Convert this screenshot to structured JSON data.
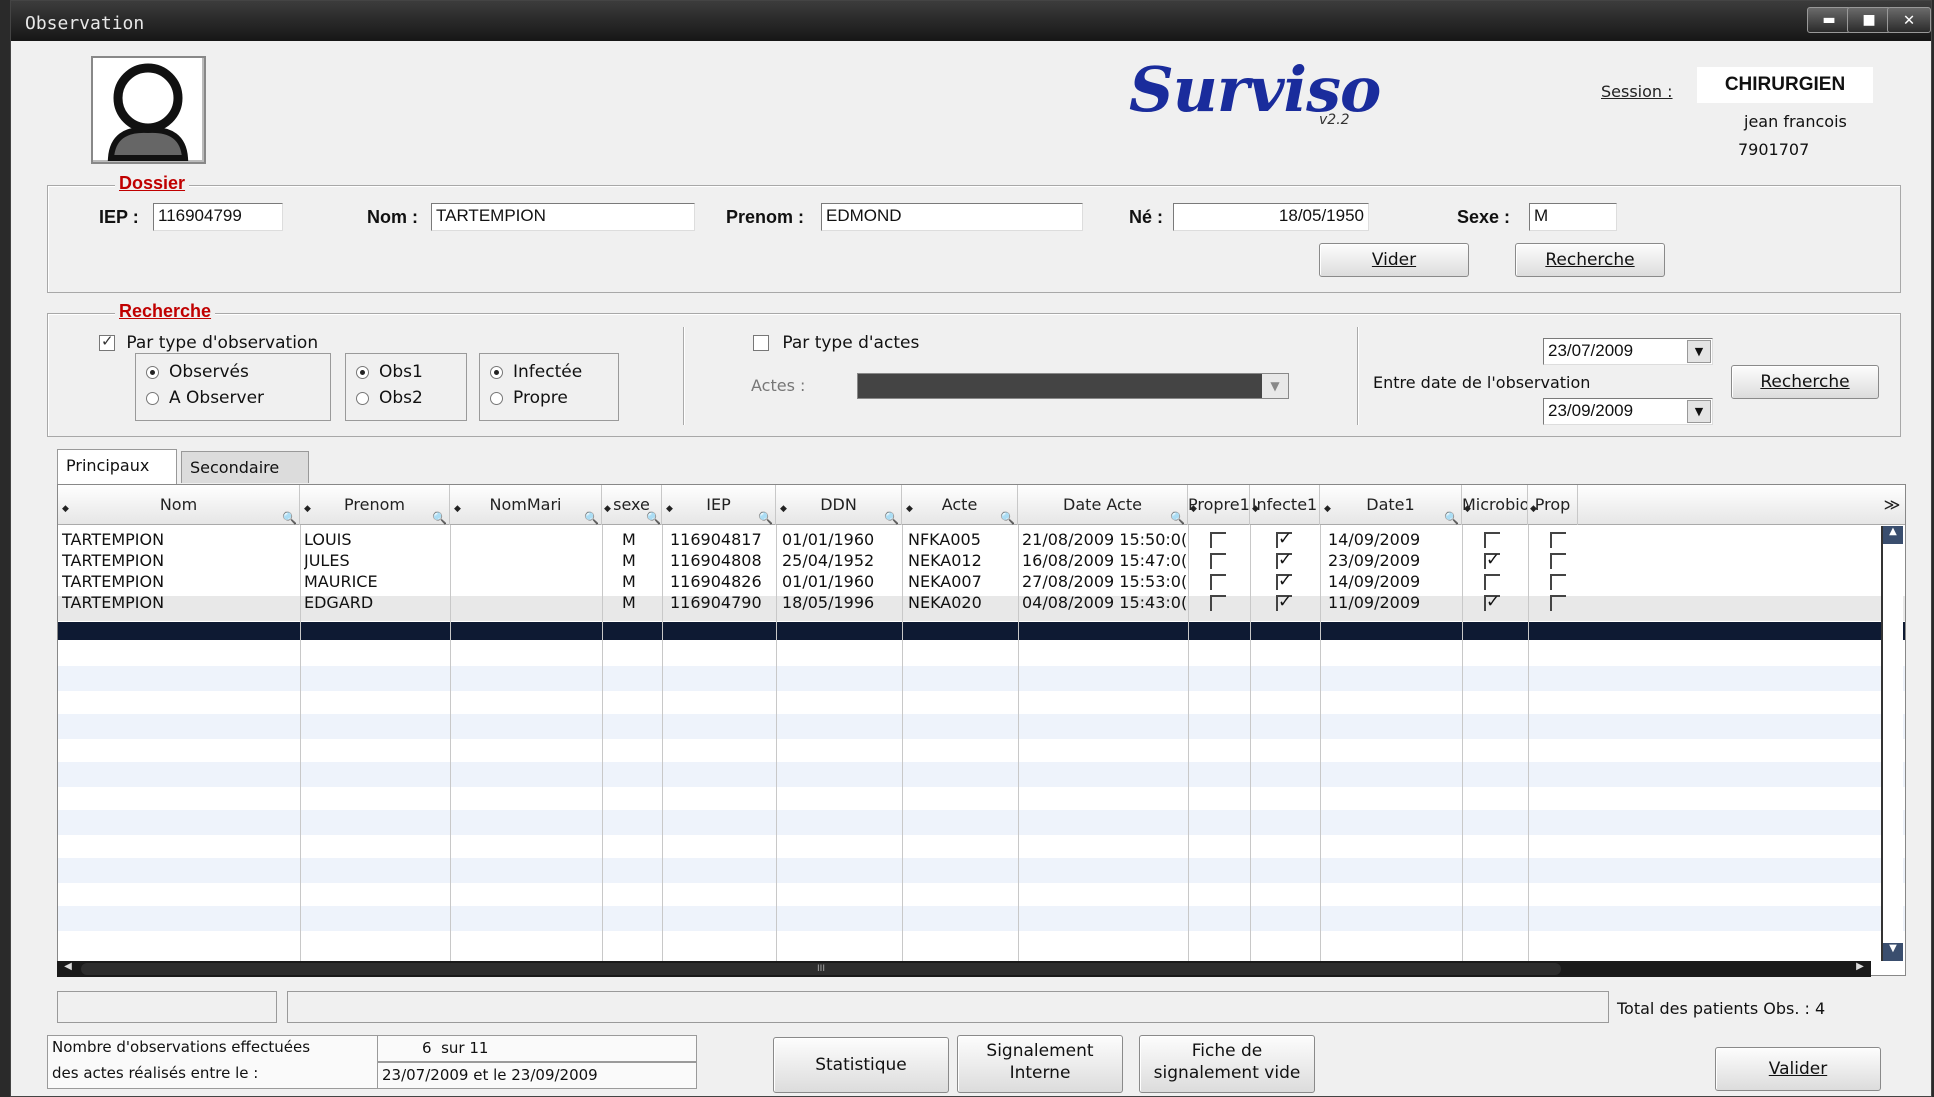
{
  "window": {
    "title": "Observation",
    "controls": [
      "minimize-icon",
      "maximize-icon",
      "close-icon"
    ]
  },
  "header": {
    "logo": "Surviso",
    "version": "v2.2",
    "session_label": "Session :",
    "session_role": "CHIRURGIEN",
    "session_user": "jean francois",
    "session_id": "7901707"
  },
  "dossier": {
    "title": "Dossier",
    "iep_label": "IEP :",
    "iep_value": "116904799",
    "nom_label": "Nom :",
    "nom_value": "TARTEMPION",
    "prenom_label": "Prenom :",
    "prenom_value": "EDMOND",
    "ne_label": "Né :",
    "ne_value": "18/05/1950",
    "sexe_label": "Sexe :",
    "sexe_value": "M",
    "vider_button": "Vider",
    "recherche_button": "Recherche"
  },
  "recherche": {
    "title": "Recherche",
    "par_type_observation": "Par type d'observation",
    "observes": "Observés",
    "a_observer": "A Observer",
    "obs1": "Obs1",
    "obs2": "Obs2",
    "infectee": "Infectée",
    "propre": "Propre",
    "par_type_actes": "Par type d'actes",
    "actes_label": "Actes :",
    "date_from": "23/07/2009",
    "date_label": "Entre date de l'observation",
    "date_to": "23/09/2009",
    "recherche_button": "Recherche"
  },
  "tabs": [
    "Principaux",
    "Secondaire"
  ],
  "table": {
    "columns": [
      "Nom",
      "Prenom",
      "NomMari",
      "sexe",
      "IEP",
      "DDN",
      "Acte",
      "Date Acte",
      "Propre1",
      "Infecte1",
      "Date1",
      "Microbio",
      "Prop"
    ],
    "rows": [
      {
        "nom": "TARTEMPION",
        "prenom": "LOUIS",
        "nommari": "",
        "sexe": "M",
        "iep": "116904817",
        "ddn": "01/01/1960",
        "acte": "NFKA005",
        "date_acte": "21/08/2009 15:50:0(",
        "propre1": false,
        "infecte1": true,
        "date1": "14/09/2009",
        "microbio": false
      },
      {
        "nom": "TARTEMPION",
        "prenom": "JULES",
        "nommari": "",
        "sexe": "M",
        "iep": "116904808",
        "ddn": "25/04/1952",
        "acte": "NEKA012",
        "date_acte": "16/08/2009 15:47:0(",
        "propre1": false,
        "infecte1": true,
        "date1": "23/09/2009",
        "microbio": true
      },
      {
        "nom": "TARTEMPION",
        "prenom": "MAURICE",
        "nommari": "",
        "sexe": "M",
        "iep": "116904826",
        "ddn": "01/01/1960",
        "acte": "NEKA007",
        "date_acte": "27/08/2009 15:53:0(",
        "propre1": false,
        "infecte1": true,
        "date1": "14/09/2009",
        "microbio": false
      },
      {
        "nom": "TARTEMPION",
        "prenom": "EDGARD",
        "nommari": "",
        "sexe": "M",
        "iep": "116904790",
        "ddn": "18/05/1996",
        "acte": "NEKA020",
        "date_acte": "04/08/2009 15:43:0(",
        "propre1": false,
        "infecte1": true,
        "date1": "11/09/2009",
        "microbio": true
      }
    ],
    "scroll_grip": "III"
  },
  "footer": {
    "total_label": "Total des patients Obs. : 4",
    "nb_obs_label": "Nombre d'observations effectuées",
    "nb_obs_value": "6  sur 11",
    "actes_label": "des actes réalisés entre le :",
    "actes_value": "23/07/2009 et le 23/09/2009",
    "statistique_button": "Statistique",
    "signalement_interne_l1": "Signalement",
    "signalement_interne_l2": "Interne",
    "fiche_l1": "Fiche de",
    "fiche_l2": "signalement vide",
    "valider_button": "Valider"
  }
}
